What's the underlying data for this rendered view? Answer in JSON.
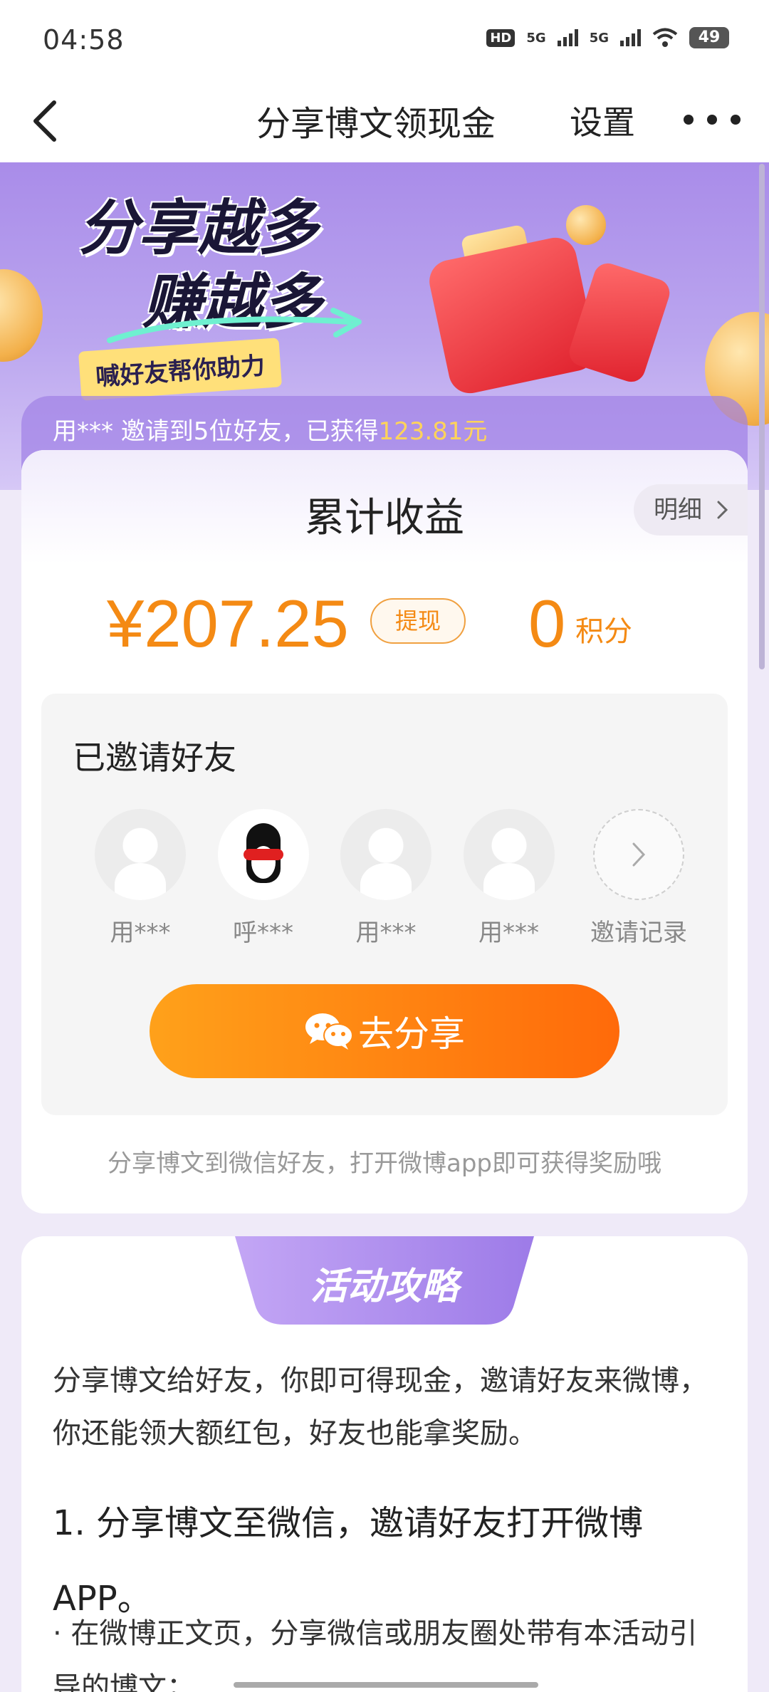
{
  "status_bar": {
    "time": "04:58",
    "hd_badge": "HD",
    "network1": "5G",
    "network2": "5G",
    "battery": "49"
  },
  "nav": {
    "title": "分享博文领现金",
    "settings_label": "设置"
  },
  "banner": {
    "headline_line1": "分享越多",
    "headline_line2": "赚越多",
    "tag": "喊好友帮你助力",
    "ticker_prefix": "用*** 邀请到5位好友，已获得",
    "ticker_amount": "123.81元"
  },
  "earnings": {
    "title": "累计收益",
    "detail_label": "明细",
    "amount": "¥207.25",
    "withdraw_label": "提现",
    "points_value": "0",
    "points_unit": "积分"
  },
  "invited": {
    "title": "已邀请好友",
    "friends": [
      {
        "name": "用***"
      },
      {
        "name": "呼***"
      },
      {
        "name": "用***"
      },
      {
        "name": "用***"
      }
    ],
    "record_label": "邀请记录",
    "share_button": "去分享",
    "hint": "分享博文到微信好友，打开微博app即可获得奖励哦"
  },
  "guide": {
    "tab_label": "活动攻略",
    "intro": "分享博文给好友，你即可得现金，邀请好友来微博，你还能领大额红包，好友也能拿奖励。",
    "step1": "1. 分享博文至微信，邀请好友打开微博APP。",
    "bullet1": "· 在微博正文页，分享微信或朋友圈处带有本活动引导的博文；"
  },
  "colors": {
    "accent_orange": "#f48a14",
    "banner_purple": "#a98ce9",
    "ticker_highlight": "#ffd35a"
  }
}
